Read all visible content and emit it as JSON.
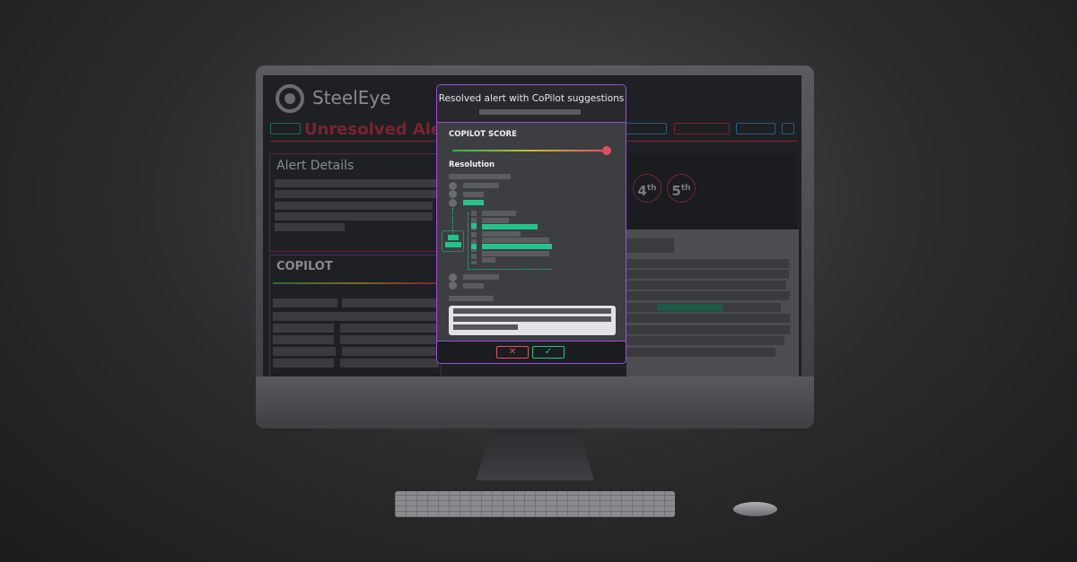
{
  "app": {
    "brand": "SteelEye",
    "page_title": "Unresolved Alerts"
  },
  "alert_details": {
    "title": "Alert Details"
  },
  "copilot_panel": {
    "title": "COPILOT"
  },
  "ranks": [
    {
      "num": "4",
      "suffix": "th"
    },
    {
      "num": "5",
      "suffix": "th"
    }
  ],
  "modal": {
    "title": "Resolved alert with CoPilot suggestions",
    "score_label": "COPILOT SCORE",
    "score_level": 0.97,
    "resolution_label": "Resolution",
    "reject_icon": "close-icon",
    "accept_icon": "check-icon"
  },
  "colors": {
    "accent_purple": "#9b4fd6",
    "green": "#23c48a",
    "red": "#e0505e"
  }
}
